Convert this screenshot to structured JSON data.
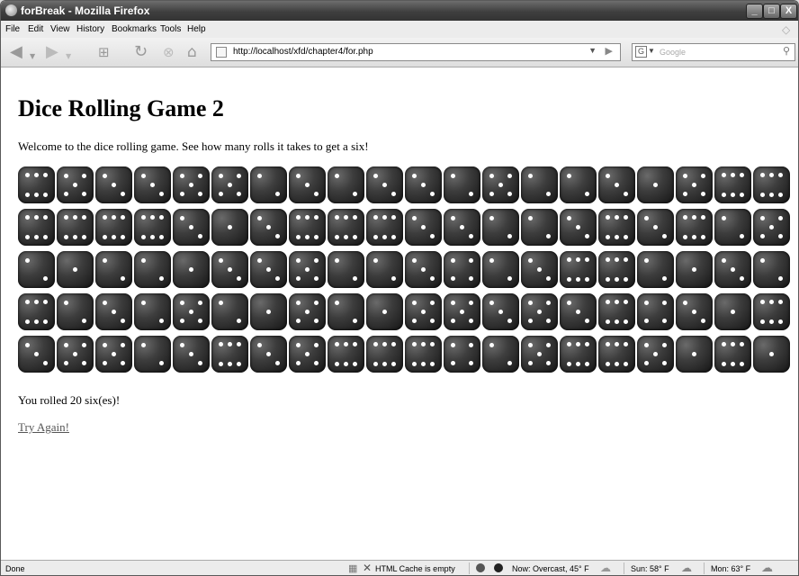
{
  "window": {
    "title": "forBreak - Mozilla Firefox",
    "buttons": [
      "_",
      "□",
      "X"
    ]
  },
  "menu": [
    "File",
    "Edit",
    "View",
    "History",
    "Bookmarks",
    "Tools",
    "Help"
  ],
  "toolbar": {
    "url": "http://localhost/xfd/chapter4/for.php",
    "search_placeholder": "Google",
    "icons": [
      "back-icon",
      "forward-icon",
      "new-tab-icon",
      "reload-icon",
      "stop-icon",
      "home-icon",
      "page-icon",
      "go-icon",
      "search-engine-icon",
      "magnifier-icon"
    ]
  },
  "page": {
    "heading": "Dice Rolling Game 2",
    "intro": "Welcome to the dice rolling game. See how many rolls it takes to get a six!",
    "result": "You rolled 20 six(es)!",
    "link": "Try Again!"
  },
  "dice_rows": [
    [
      6,
      5,
      3,
      3,
      5,
      5,
      2,
      3,
      2,
      3,
      3,
      2,
      5,
      2,
      2,
      3,
      1,
      5,
      6,
      6
    ],
    [
      6,
      6,
      6,
      6,
      3,
      1,
      3,
      6,
      6,
      6,
      3,
      3,
      2,
      2,
      3,
      6,
      3,
      6,
      2,
      5
    ],
    [
      2,
      1,
      2,
      2,
      1,
      3,
      3,
      5,
      2,
      2,
      3,
      4,
      2,
      3,
      6,
      6,
      2,
      1,
      3,
      2
    ],
    [
      6,
      2,
      3,
      2,
      5,
      2,
      1,
      5,
      2,
      1,
      5,
      5,
      3,
      5,
      3,
      6,
      4,
      3,
      1,
      6
    ],
    [
      3,
      5,
      5,
      2,
      3,
      6,
      3,
      5,
      6,
      6,
      6,
      4,
      2,
      5,
      6,
      6,
      5,
      1,
      6,
      1
    ]
  ],
  "status": {
    "left": "Done",
    "cache": "HTML Cache is empty",
    "now": "Now: Overcast, 45° F",
    "sun": "Sun: 58° F",
    "mon": "Mon: 63° F"
  }
}
